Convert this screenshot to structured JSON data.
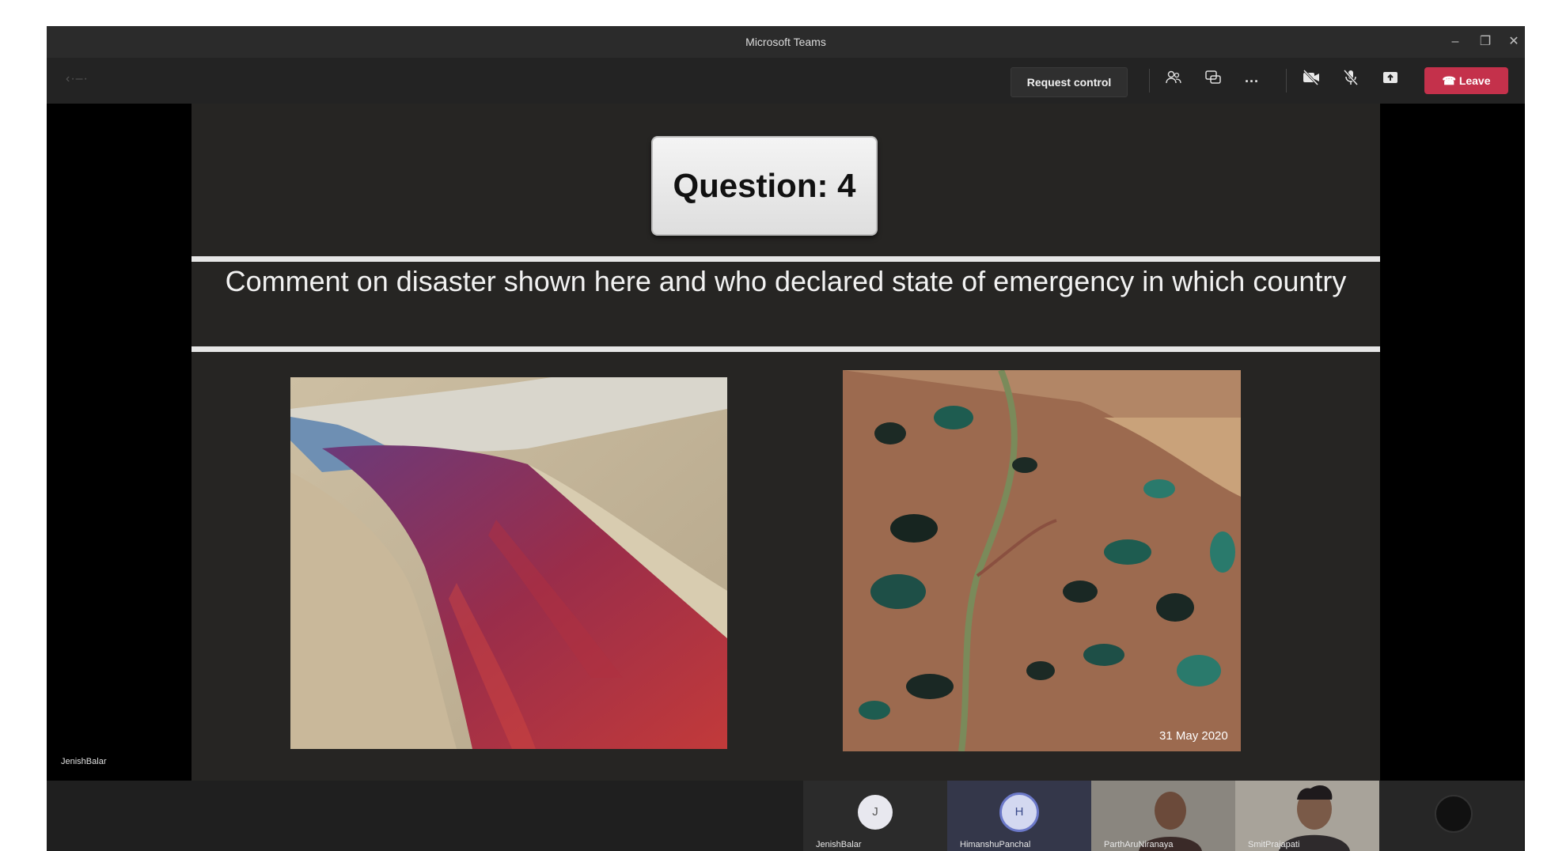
{
  "window": {
    "title": "Microsoft Teams"
  },
  "toolbar": {
    "back_label": "‹·–·",
    "request_control_label": "Request control",
    "icons": [
      "people-icon",
      "chat-icon",
      "more-icon",
      "camera-off-icon",
      "mic-off-icon",
      "share-icon"
    ],
    "more_label": "···",
    "leave_label": "Leave"
  },
  "slide": {
    "question_label": "Question: 4",
    "question_text": "Comment on disaster shown here and who declared state of emergency in which country",
    "map_date": "31 May 2020"
  },
  "presenter": {
    "name": "JenishBalar"
  },
  "participants": [
    {
      "name": "JenishBalar",
      "initial": "J"
    },
    {
      "name": "HimanshuPanchal",
      "initial": "H"
    },
    {
      "name": "ParthAruNiranaya",
      "initial": ""
    },
    {
      "name": "SmitPrajapati",
      "initial": ""
    }
  ],
  "colors": {
    "leave": "#c4314b",
    "background": "#1f1f1f"
  }
}
